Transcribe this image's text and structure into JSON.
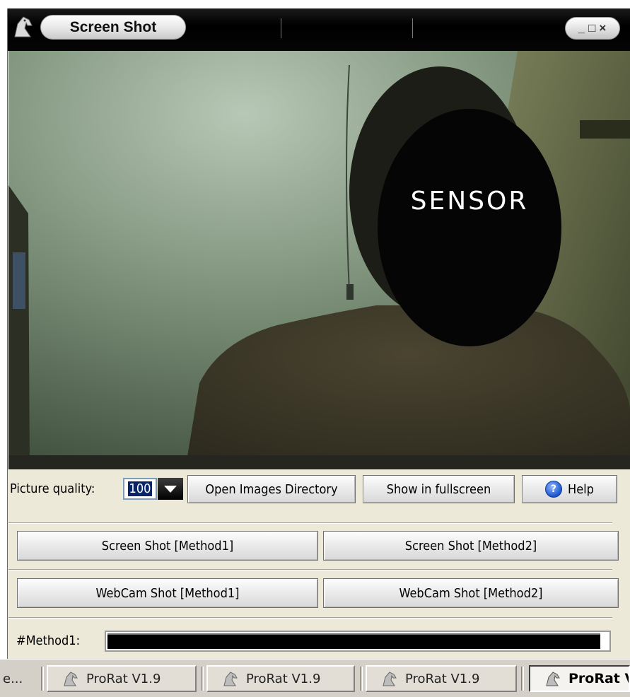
{
  "window": {
    "title": "Screen Shot",
    "controls": {
      "minimize": "_",
      "maximize": "□",
      "close": "×"
    }
  },
  "picture": {
    "overlay_text": "SENSOR"
  },
  "controls": {
    "quality_label": "Picture quality:",
    "quality_value": "100",
    "open_dir_label": "Open Images Directory",
    "fullscreen_label": "Show in fullscreen",
    "help_label": "Help",
    "screen_shot_1": "Screen Shot [Method1]",
    "screen_shot_2": "Screen Shot [Method2]",
    "webcam_shot_1": "WebCam Shot [Method1]",
    "webcam_shot_2": "WebCam Shot [Method2]",
    "method_label": "#Method1:",
    "progress_fraction": 0.985
  },
  "taskbar": {
    "truncated_item": "e...",
    "items": [
      {
        "label": "ProRat V1.9"
      },
      {
        "label": "ProRat V1.9"
      },
      {
        "label": "ProRat V1.9"
      },
      {
        "label": "ProRat V"
      }
    ]
  },
  "colors": {
    "window_face": "#ece9d8",
    "titlebar": "#000000",
    "selection": "#0a246a",
    "help_icon": "#1b55c9"
  },
  "icons": [
    "prorat-horse-icon",
    "help-question-icon",
    "dropdown-arrow-icon"
  ]
}
